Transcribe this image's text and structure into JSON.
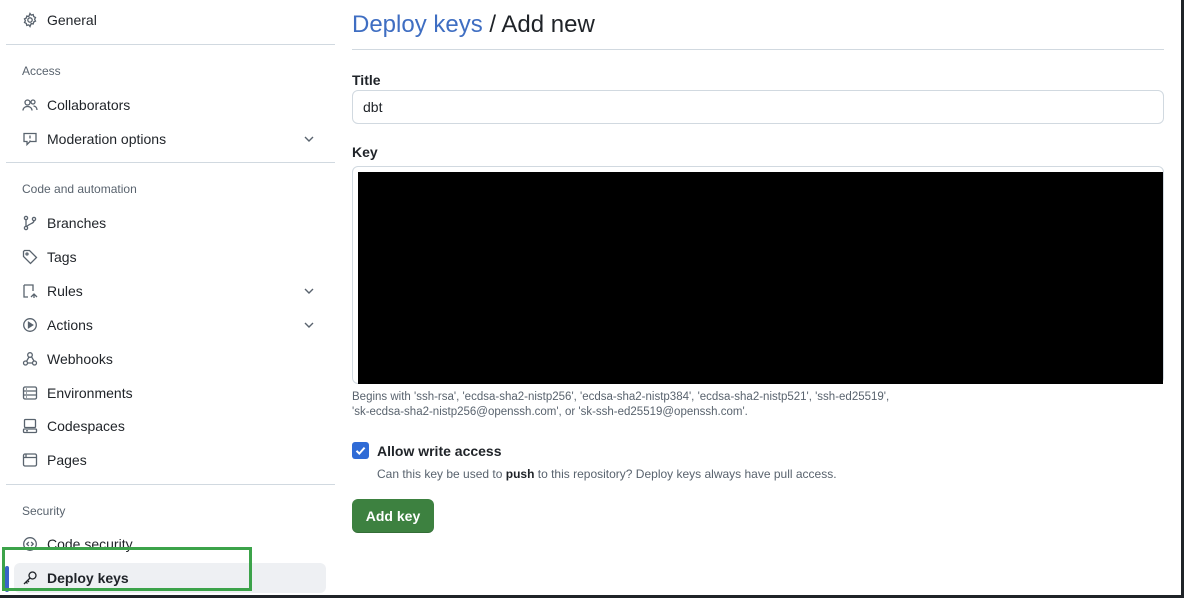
{
  "sidebar": {
    "general": {
      "label": "General",
      "icon": "gear-icon"
    },
    "sections": {
      "access": {
        "title": "Access"
      },
      "code_automation": {
        "title": "Code and automation"
      },
      "security": {
        "title": "Security"
      }
    },
    "items": {
      "collaborators": {
        "label": "Collaborators",
        "icon": "people-icon"
      },
      "moderation": {
        "label": "Moderation options",
        "icon": "report-icon"
      },
      "branches": {
        "label": "Branches",
        "icon": "git-branch-icon"
      },
      "tags": {
        "label": "Tags",
        "icon": "tag-icon"
      },
      "rules": {
        "label": "Rules",
        "icon": "rules-icon"
      },
      "actions": {
        "label": "Actions",
        "icon": "play-icon"
      },
      "webhooks": {
        "label": "Webhooks",
        "icon": "webhook-icon"
      },
      "environments": {
        "label": "Environments",
        "icon": "server-icon"
      },
      "codespaces": {
        "label": "Codespaces",
        "icon": "codespaces-icon"
      },
      "pages": {
        "label": "Pages",
        "icon": "browser-icon"
      },
      "code_security": {
        "label": "Code security",
        "icon": "codescan-icon"
      },
      "deploy_keys": {
        "label": "Deploy keys",
        "icon": "key-icon",
        "active": true
      }
    }
  },
  "main": {
    "breadcrumb": {
      "parent": "Deploy keys",
      "separator": "/",
      "current": "Add new"
    },
    "title_field": {
      "label": "Title",
      "value": "dbt"
    },
    "key_field": {
      "label": "Key",
      "hint_line1": "Begins with 'ssh-rsa', 'ecdsa-sha2-nistp256', 'ecdsa-sha2-nistp384', 'ecdsa-sha2-nistp521', 'ssh-ed25519',",
      "hint_line2": "'sk-ecdsa-sha2-nistp256@openssh.com', or 'sk-ssh-ed25519@openssh.com'."
    },
    "write_access": {
      "checked": true,
      "label": "Allow write access",
      "note_pre": "Can this key be used to ",
      "note_bold": "push",
      "note_post": " to this repository? Deploy keys always have pull access."
    },
    "submit_label": "Add key"
  },
  "colors": {
    "link": "#3f6ec2",
    "primary_button": "#3d8140",
    "checkbox": "#2f6bd6",
    "active_indicator": "#3a64c8",
    "highlight_outline": "#3ca34a"
  }
}
